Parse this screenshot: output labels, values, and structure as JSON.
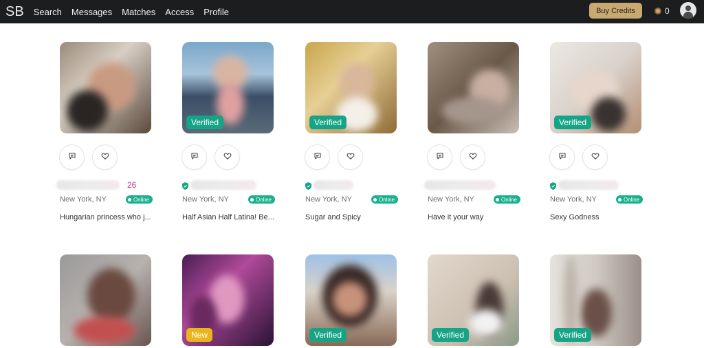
{
  "nav": {
    "logo": "SB",
    "links": [
      "Search",
      "Messages",
      "Matches",
      "Access",
      "Profile"
    ],
    "buy_credits": "Buy Credits",
    "credit_count": "0"
  },
  "profiles_row1": [
    {
      "age": "26",
      "verified_shield": false,
      "location": "New York, NY",
      "online": "Online",
      "badge": "",
      "tagline": "Hungarian princess who j..."
    },
    {
      "age": "",
      "verified_shield": true,
      "location": "New York, NY",
      "online": "Online",
      "badge": "Verified",
      "tagline": "Half Asian Half Latina! Be..."
    },
    {
      "age": "",
      "verified_shield": true,
      "location": "New York, NY",
      "online": "Online",
      "badge": "Verified",
      "tagline": "Sugar and Spicy"
    },
    {
      "age": "",
      "verified_shield": false,
      "location": "New York, NY",
      "online": "Online",
      "badge": "",
      "tagline": "Have it your way"
    },
    {
      "age": "",
      "verified_shield": true,
      "location": "New York, NY",
      "online": "Online",
      "badge": "Verified",
      "tagline": "Sexy Godness"
    }
  ],
  "profiles_row2": [
    {
      "badge": ""
    },
    {
      "badge": "New"
    },
    {
      "badge": "Verified"
    },
    {
      "badge": "Verified"
    },
    {
      "badge": "Verified"
    }
  ],
  "colors": {
    "topbar": "#1b1d1f",
    "gold": "#c9a972",
    "verified": "#17a486",
    "new": "#e8b61c",
    "online": "#19b08c",
    "age": "#c2398a"
  }
}
